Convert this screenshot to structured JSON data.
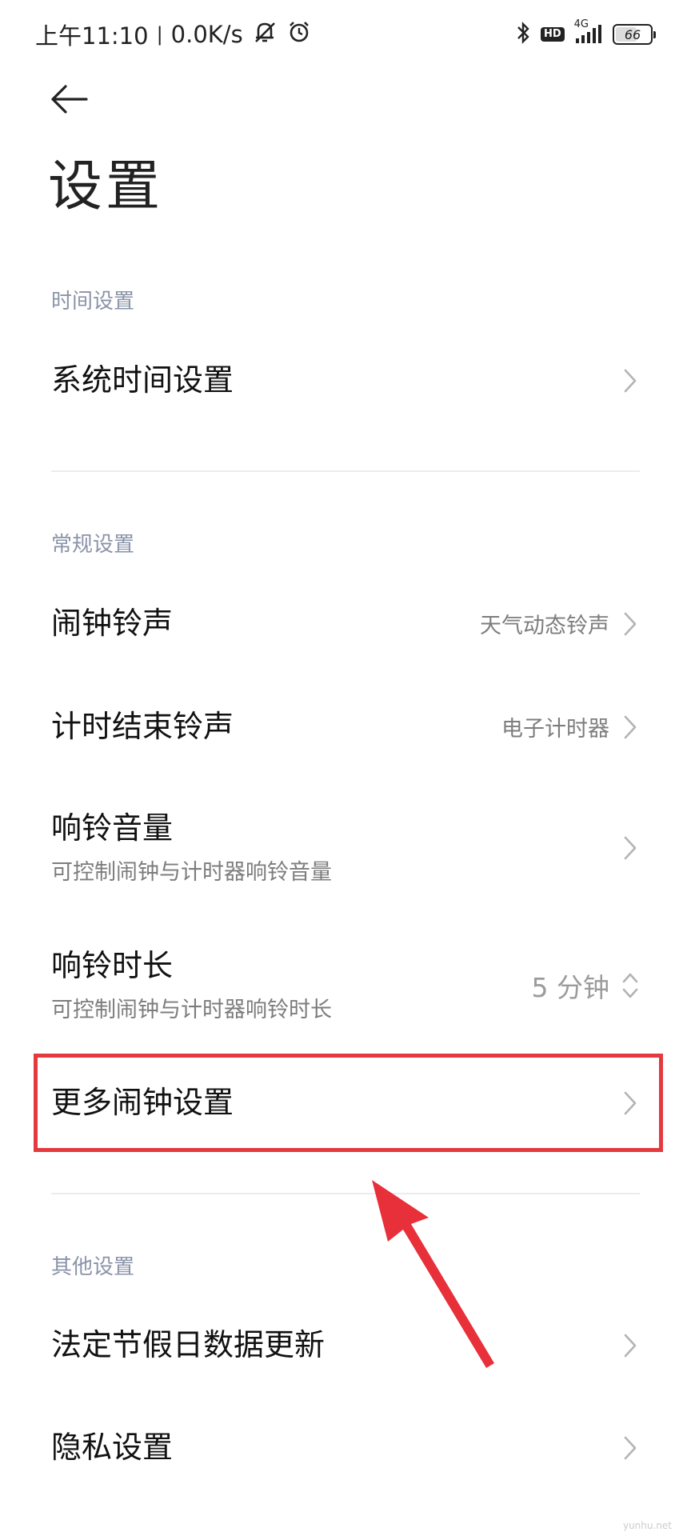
{
  "status_bar": {
    "time": "上午11:10",
    "separator": "|",
    "net_speed": "0.0K/s",
    "icons_left": [
      "muted-bell-icon",
      "alarm-clock-icon"
    ],
    "icons_right": [
      "bluetooth-icon",
      "hd-badge",
      "signal-icon",
      "battery-icon"
    ],
    "hd": "HD",
    "network": "4G",
    "battery_level": "66"
  },
  "header": {
    "back_icon": "back-arrow-icon",
    "title": "设置"
  },
  "sections": {
    "time": {
      "label": "时间设置",
      "items": {
        "system_time": {
          "title": "系统时间设置"
        }
      }
    },
    "general": {
      "label": "常规设置",
      "items": {
        "alarm_ringtone": {
          "title": "闹钟铃声",
          "value": "天气动态铃声"
        },
        "timer_end_ringtone": {
          "title": "计时结束铃声",
          "value": "电子计时器"
        },
        "ring_volume": {
          "title": "响铃音量",
          "subtitle": "可控制闹钟与计时器响铃音量"
        },
        "ring_duration": {
          "title": "响铃时长",
          "subtitle": "可控制闹钟与计时器响铃时长",
          "value": "5 分钟"
        },
        "more_alarm": {
          "title": "更多闹钟设置"
        }
      }
    },
    "other": {
      "label": "其他设置",
      "items": {
        "holiday_update": {
          "title": "法定节假日数据更新"
        },
        "privacy": {
          "title": "隐私设置"
        }
      }
    }
  },
  "annotation": {
    "highlight_color": "#e43a3f",
    "arrow_color": "#e8303a"
  },
  "watermark": "yunhu.net"
}
